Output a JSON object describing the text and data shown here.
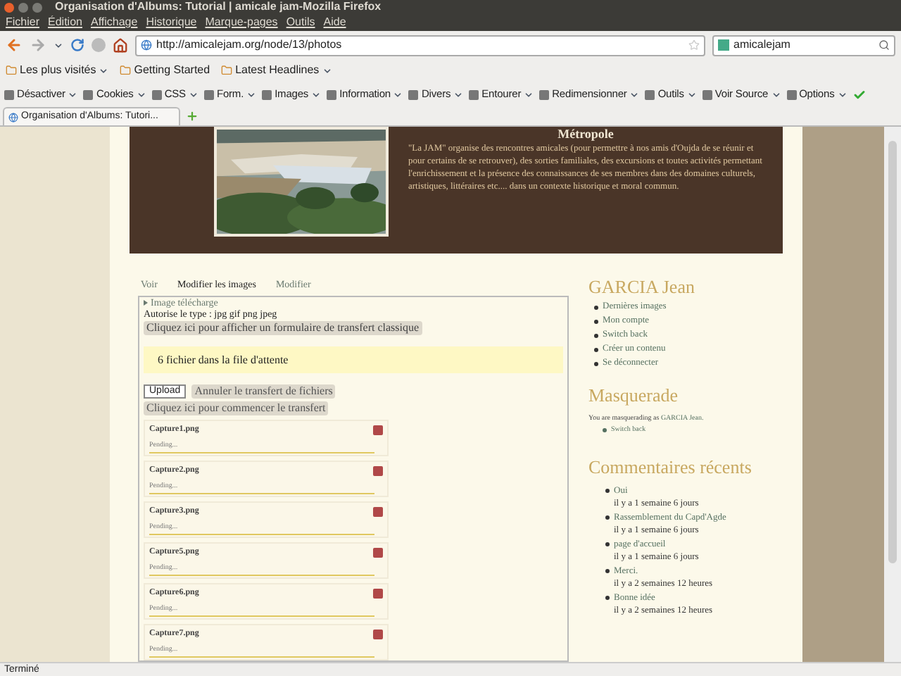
{
  "window": {
    "title": "Organisation d'Albums: Tutorial | amicale jam-Mozilla Firefox"
  },
  "menu": [
    "Fichier",
    "Édition",
    "Affichage",
    "Historique",
    "Marque-pages",
    "Outils",
    "Aide"
  ],
  "nav": {
    "url": "http://amicalejam.org/node/13/photos",
    "search": "amicalejam"
  },
  "bookmarks": [
    "Les plus visités",
    "Getting Started",
    "Latest Headlines"
  ],
  "toolbar": [
    "Désactiver",
    "Cookies",
    "CSS",
    "Form.",
    "Images",
    "Information",
    "Divers",
    "Entourer",
    "Redimensionner",
    "Outils",
    "Voir Source",
    "Options"
  ],
  "browser_tab": {
    "title": "Organisation d'Albums: Tutori..."
  },
  "banner": {
    "heading": "Métropole",
    "text": "\"La JAM\" organise des rencontres amicales (pour permettre à nos amis d'Oujda de se réunir et pour certains de se retrouver), des sorties familiales, des excursions et toutes activités permettant l'enrichissement et la présence des connaissances de ses membres dans des domaines culturels, artistiques, littéraires etc.... dans un contexte historique et moral commun."
  },
  "page_tabs": [
    {
      "label": "Voir",
      "selected": false
    },
    {
      "label": "Modifier les images",
      "selected": true
    },
    {
      "label": "Modifier",
      "selected": false
    }
  ],
  "upload": {
    "legend": "Image télécharge",
    "allowed": "Autorise le type : jpg gif png jpeg",
    "classic_button": "Cliquez ici pour afficher un formulaire de transfert classique",
    "queue_message": "6 fichier dans la file d'attente",
    "upload_button": "Upload",
    "cancel_button": "Annuler le transfert de fichiers",
    "start_button": "Cliquez ici pour commencer le transfert",
    "files": [
      {
        "name": "Capture1.png",
        "status": "Pending..."
      },
      {
        "name": "Capture2.png",
        "status": "Pending..."
      },
      {
        "name": "Capture3.png",
        "status": "Pending..."
      },
      {
        "name": "Capture5.png",
        "status": "Pending..."
      },
      {
        "name": "Capture6.png",
        "status": "Pending..."
      },
      {
        "name": "Capture7.png",
        "status": "Pending..."
      }
    ]
  },
  "sidebar": {
    "user": {
      "title": "GARCIA Jean",
      "links": [
        "Dernières images",
        "Mon compte",
        "Switch back",
        "Créer un contenu",
        "Se déconnecter"
      ]
    },
    "masquerade": {
      "title": "Masquerade",
      "text": "You are masquerading as",
      "user": "GARCIA Jean.",
      "link": "Switch back"
    },
    "comments": {
      "title": "Commentaires récents",
      "items": [
        {
          "title": "Oui",
          "time": "il y a 1 semaine 6 jours"
        },
        {
          "title": "Rassemblement du Capd'Agde",
          "time": "il y a 1 semaine 6 jours"
        },
        {
          "title": "page d'accueil",
          "time": "il y a 1 semaine 6 jours"
        },
        {
          "title": "Merci.",
          "time": "il y a 2 semaines 12 heures"
        },
        {
          "title": "Bonne idée",
          "time": "il y a 2 semaines 12 heures"
        }
      ]
    }
  },
  "status_bar": "Terminé"
}
